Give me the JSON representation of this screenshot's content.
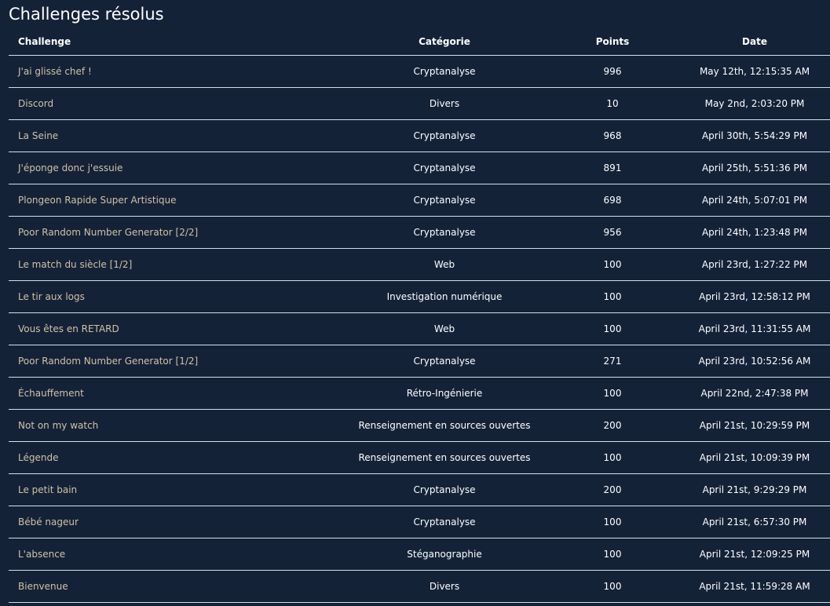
{
  "page": {
    "title": "Challenges résolus"
  },
  "table": {
    "headers": {
      "challenge": "Challenge",
      "category": "Catégorie",
      "points": "Points",
      "date": "Date"
    },
    "rows": [
      {
        "name": "J'ai glissé chef !",
        "category": "Cryptanalyse",
        "points": "996",
        "date": "May 12th, 12:15:35 AM"
      },
      {
        "name": "Discord",
        "category": "Divers",
        "points": "10",
        "date": "May 2nd, 2:03:20 PM"
      },
      {
        "name": "La Seine",
        "category": "Cryptanalyse",
        "points": "968",
        "date": "April 30th, 5:54:29 PM"
      },
      {
        "name": "J'éponge donc j'essuie",
        "category": "Cryptanalyse",
        "points": "891",
        "date": "April 25th, 5:51:36 PM"
      },
      {
        "name": "Plongeon Rapide Super Artistique",
        "category": "Cryptanalyse",
        "points": "698",
        "date": "April 24th, 5:07:01 PM"
      },
      {
        "name": "Poor Random Number Generator [2/2]",
        "category": "Cryptanalyse",
        "points": "956",
        "date": "April 24th, 1:23:48 PM"
      },
      {
        "name": "Le match du siècle [1/2]",
        "category": "Web",
        "points": "100",
        "date": "April 23rd, 1:27:22 PM"
      },
      {
        "name": "Le tir aux logs",
        "category": "Investigation numérique",
        "points": "100",
        "date": "April 23rd, 12:58:12 PM"
      },
      {
        "name": "Vous êtes en RETARD",
        "category": "Web",
        "points": "100",
        "date": "April 23rd, 11:31:55 AM"
      },
      {
        "name": "Poor Random Number Generator [1/2]",
        "category": "Cryptanalyse",
        "points": "271",
        "date": "April 23rd, 10:52:56 AM"
      },
      {
        "name": "Échauffement",
        "category": "Rétro-Ingénierie",
        "points": "100",
        "date": "April 22nd, 2:47:38 PM"
      },
      {
        "name": "Not on my watch",
        "category": "Renseignement en sources ouvertes",
        "points": "200",
        "date": "April 21st, 10:29:59 PM"
      },
      {
        "name": "Légende",
        "category": "Renseignement en sources ouvertes",
        "points": "100",
        "date": "April 21st, 10:09:39 PM"
      },
      {
        "name": "Le petit bain",
        "category": "Cryptanalyse",
        "points": "200",
        "date": "April 21st, 9:29:29 PM"
      },
      {
        "name": "Bébé nageur",
        "category": "Cryptanalyse",
        "points": "100",
        "date": "April 21st, 6:57:30 PM"
      },
      {
        "name": "L'absence",
        "category": "Stéganographie",
        "points": "100",
        "date": "April 21st, 12:09:25 PM"
      },
      {
        "name": "Bienvenue",
        "category": "Divers",
        "points": "100",
        "date": "April 21st, 11:59:28 AM"
      }
    ]
  },
  "colors": {
    "background": "#142238",
    "link": "#d1c2a4",
    "text": "#ffffff",
    "rule": "#d9dee6"
  }
}
